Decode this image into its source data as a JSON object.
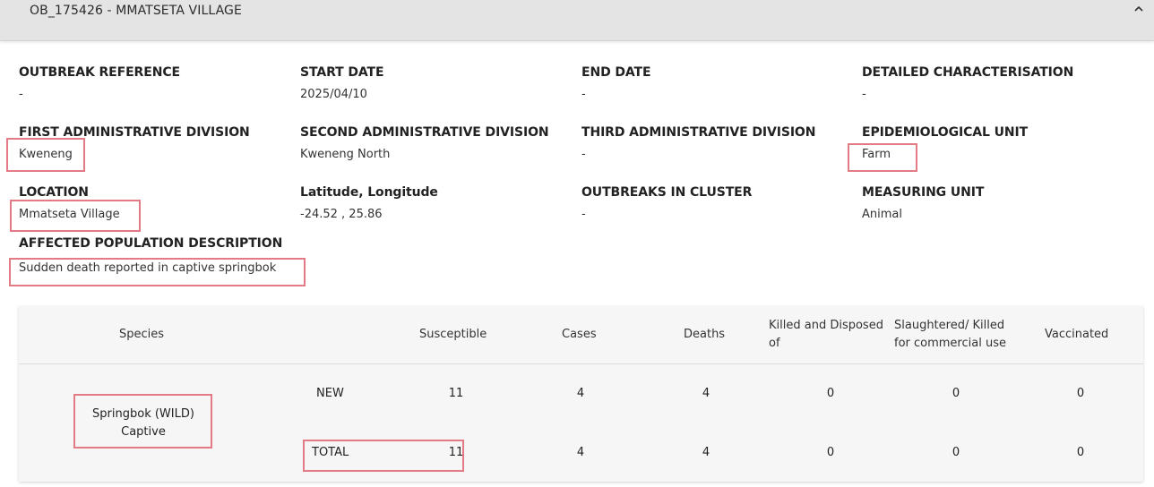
{
  "header": {
    "title": "OB_175426 - MMATSETA VILLAGE",
    "collapse_icon": "chevron-up-icon"
  },
  "fields": {
    "outbreak_reference": {
      "label": "OUTBREAK REFERENCE",
      "value": "-"
    },
    "start_date": {
      "label": "START DATE",
      "value": "2025/04/10"
    },
    "end_date": {
      "label": "END DATE",
      "value": "-"
    },
    "detailed_characterisation": {
      "label": "DETAILED CHARACTERISATION",
      "value": "-"
    },
    "first_admin_division": {
      "label": "FIRST ADMINISTRATIVE DIVISION",
      "value": "Kweneng"
    },
    "second_admin_division": {
      "label": "SECOND ADMINISTRATIVE DIVISION",
      "value": "Kweneng North"
    },
    "third_admin_division": {
      "label": "THIRD ADMINISTRATIVE DIVISION",
      "value": "-"
    },
    "epidemiological_unit": {
      "label": "EPIDEMIOLOGICAL UNIT",
      "value": "Farm"
    },
    "location": {
      "label": "LOCATION",
      "value": "Mmatseta Village"
    },
    "lat_long": {
      "label": "Latitude, Longitude",
      "value": "-24.52 , 25.86"
    },
    "outbreaks_in_cluster": {
      "label": "OUTBREAKS IN CLUSTER",
      "value": "-"
    },
    "measuring_unit": {
      "label": "MEASURING UNIT",
      "value": "Animal"
    },
    "affected_population": {
      "label": "AFFECTED POPULATION DESCRIPTION",
      "value": "Sudden death reported in captive springbok"
    }
  },
  "table": {
    "headers": {
      "species": "Species",
      "susceptible": "Susceptible",
      "cases": "Cases",
      "deaths": "Deaths",
      "killed": "Killed and Disposed of",
      "slaughtered": "Slaughtered/ Killed for commercial use",
      "vaccinated": "Vaccinated"
    },
    "species_line1": "Springbok (WILD)",
    "species_line2": "Captive",
    "rows": [
      {
        "type": "NEW",
        "susceptible": "11",
        "cases": "4",
        "deaths": "4",
        "killed": "0",
        "slaughtered": "0",
        "vaccinated": "0"
      },
      {
        "type": "TOTAL",
        "susceptible": "11",
        "cases": "4",
        "deaths": "4",
        "killed": "0",
        "slaughtered": "0",
        "vaccinated": "0"
      }
    ]
  },
  "colors": {
    "header_bg": "#e4e4e4",
    "highlight": "#e27b86",
    "table_bg": "#f6f6f6"
  }
}
